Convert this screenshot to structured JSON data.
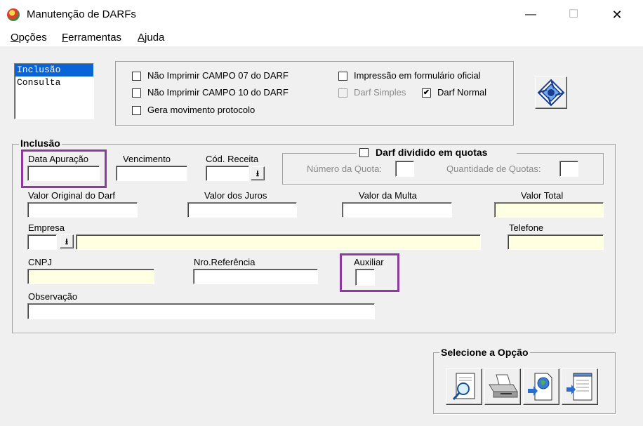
{
  "window": {
    "title": "Manutenção de DARFs",
    "minimize": "—",
    "maximize": "☐",
    "close": "✕"
  },
  "menu": {
    "opcoes": {
      "u": "O",
      "rest": "pções"
    },
    "ferramentas": {
      "u": "F",
      "rest": "erramentas"
    },
    "ajuda": {
      "u": "A",
      "rest": "juda"
    }
  },
  "mode_list": {
    "items": [
      "Inclusão",
      "Consulta"
    ],
    "selected": "Inclusão"
  },
  "options": {
    "nao_imprimir_07": {
      "label": "Não Imprimir CAMPO 07 do DARF",
      "checked": false
    },
    "nao_imprimir_10": {
      "label": "Não Imprimir CAMPO 10 do DARF",
      "checked": false
    },
    "gera_movimento": {
      "label": "Gera movimento protocolo",
      "checked": false
    },
    "impressao_formulario": {
      "label": "Impressão em formulário oficial",
      "checked": false
    },
    "darf_simples": {
      "label": "Darf Simples",
      "checked": false,
      "disabled": true
    },
    "darf_normal": {
      "label": "Darf Normal",
      "checked": true,
      "mark": "✔"
    }
  },
  "inclusao": {
    "group_title": "Inclusão",
    "data_apuracao": {
      "label": "Data Apuração",
      "value": ""
    },
    "vencimento": {
      "label": "Vencimento",
      "value": ""
    },
    "cod_receita": {
      "label": "Cód. Receita",
      "value": ""
    },
    "dropdown_glyph": "⭳",
    "quotas": {
      "title": "Darf dividido em quotas",
      "checked": false,
      "numero_quota_label": "Número da Quota:",
      "quantidade_quotas_label": "Quantidade de Quotas:"
    },
    "valor_original": {
      "label": "Valor Original do Darf",
      "value": ""
    },
    "valor_juros": {
      "label": "Valor dos Juros",
      "value": ""
    },
    "valor_multa": {
      "label": "Valor da Multa",
      "value": ""
    },
    "valor_total": {
      "label": "Valor Total",
      "value": ""
    },
    "empresa": {
      "label": "Empresa",
      "code": "",
      "name": ""
    },
    "telefone": {
      "label": "Telefone",
      "value": ""
    },
    "cnpj": {
      "label": "CNPJ",
      "value": ""
    },
    "nro_referencia": {
      "label": "Nro.Referência",
      "value": ""
    },
    "auxiliar": {
      "label": "Auxiliar",
      "value": ""
    },
    "observacao": {
      "label": "Observação",
      "value": ""
    }
  },
  "selecione": {
    "title": "Selecione a Opção",
    "buttons": [
      "search-document-icon",
      "printer-icon",
      "web-export-icon",
      "notepad-export-icon"
    ]
  },
  "colors": {
    "highlight": "#8c3a9c",
    "readonly_field": "#ffffe1",
    "selection": "#0a64d7"
  }
}
